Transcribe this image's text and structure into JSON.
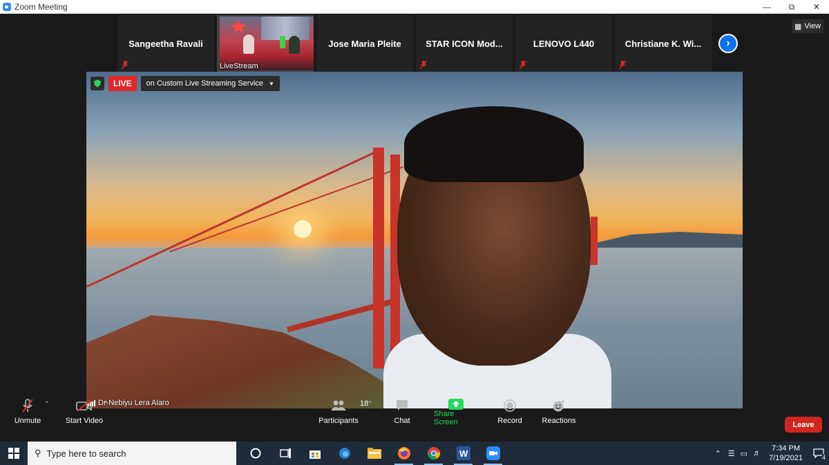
{
  "window": {
    "title": "Zoom Meeting",
    "controls": [
      "minimize-icon",
      "restore-icon",
      "close-icon"
    ]
  },
  "thumbnails": [
    {
      "name": "Sangeetha Ravali",
      "muted": true
    },
    {
      "name": "LiveStream",
      "video": true,
      "muted": true
    },
    {
      "name": "Jose  Maria Pleite",
      "muted": true
    },
    {
      "name": "STAR  ICON  Mod...",
      "muted": true
    },
    {
      "name": "LENOVO L440",
      "muted": true
    },
    {
      "name": "Christiane  K.  Wi...",
      "muted": true
    }
  ],
  "view_button": "View",
  "live": {
    "badge": "LIVE",
    "service": "on Custom Live Streaming Service"
  },
  "active_speaker": "Dr-Nebiyu Lera Alaro",
  "toolbar": {
    "unmute": "Unmute",
    "start_video": "Start Video",
    "participants": "Participants",
    "participants_count": "18",
    "chat": "Chat",
    "share_screen": "Share Screen",
    "record": "Record",
    "reactions": "Reactions",
    "leave": "Leave"
  },
  "colors": {
    "share_green": "#23d959",
    "leave_red": "#d0261f",
    "live_red": "#e02828",
    "accent_blue": "#0e72ed"
  },
  "taskbar": {
    "search_placeholder": "Type here to search",
    "time": "7:34 PM",
    "date": "7/19/2021",
    "notifications": "4",
    "apps": [
      "cortana-icon",
      "task-view-icon",
      "store-icon",
      "edge-icon",
      "file-explorer-icon",
      "firefox-icon",
      "chrome-icon",
      "word-icon",
      "zoom-icon"
    ]
  }
}
